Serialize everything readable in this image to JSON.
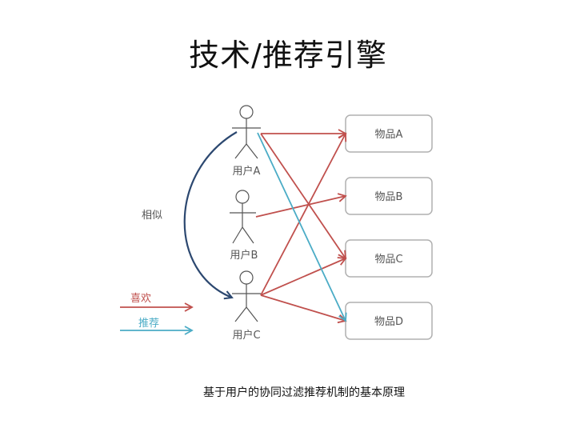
{
  "title": "技术/推荐引擎",
  "caption": "基于用户的协同过滤推荐机制的基本原理",
  "diagram": {
    "users": [
      "用户A",
      "用户B",
      "用户C"
    ],
    "items": [
      "物品A",
      "物品B",
      "物品C",
      "物品D"
    ],
    "similar_label": "相似",
    "legend": {
      "like": "喜欢",
      "recommend": "推荐"
    },
    "likes": [
      {
        "from": "用户A",
        "to": "物品A"
      },
      {
        "from": "用户A",
        "to": "物品C"
      },
      {
        "from": "用户B",
        "to": "物品B"
      },
      {
        "from": "用户C",
        "to": "物品A"
      },
      {
        "from": "用户C",
        "to": "物品C"
      },
      {
        "from": "用户C",
        "to": "物品D"
      }
    ],
    "recommends": [
      {
        "from": "用户A",
        "to": "物品D"
      }
    ],
    "similarity": {
      "from": "用户A",
      "to": "用户C"
    },
    "colors": {
      "like": "#c0504d",
      "recommend": "#4bacc6",
      "similar": "#2c4870",
      "box_border": "#b0b0b0",
      "text": "#555555"
    }
  }
}
